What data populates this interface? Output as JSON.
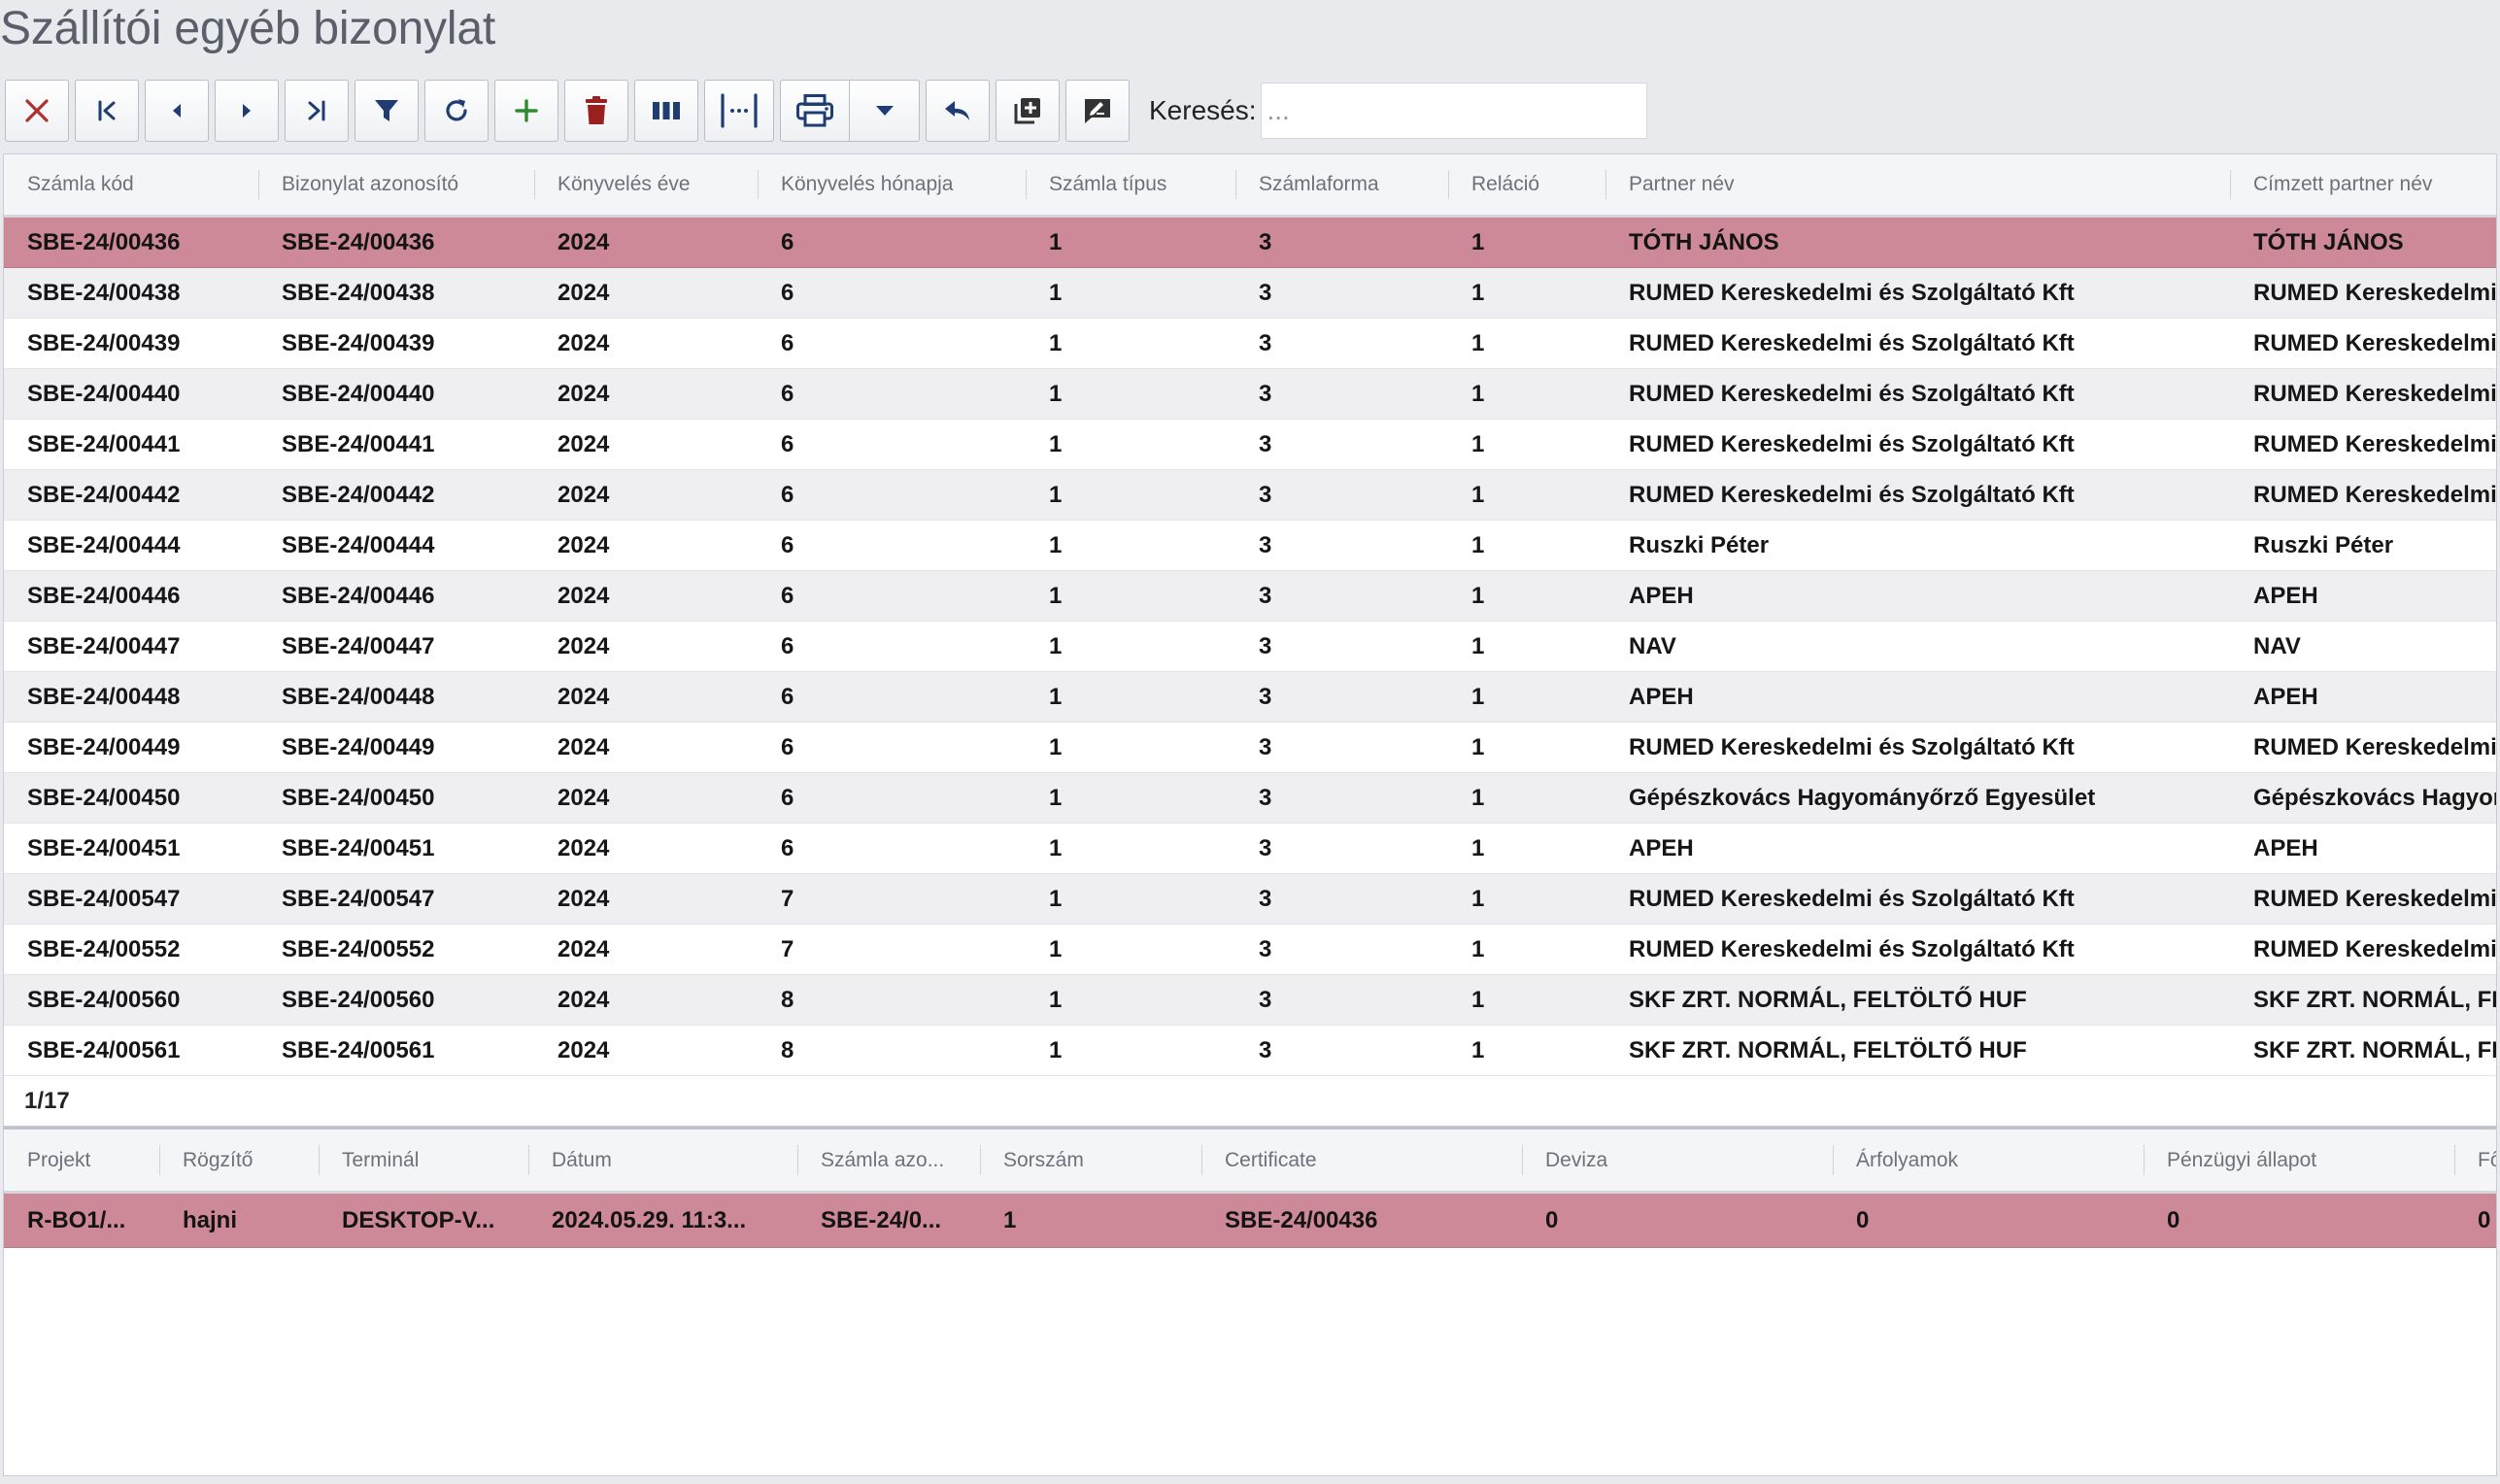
{
  "page_title": "Szállítói egyéb bizonylat",
  "toolbar": {
    "buttons": [
      {
        "name": "close-icon",
        "tooltip": ""
      },
      {
        "name": "first-record-icon"
      },
      {
        "name": "previous-record-icon"
      },
      {
        "name": "next-record-icon"
      },
      {
        "name": "last-record-icon"
      },
      {
        "name": "filter-icon"
      },
      {
        "name": "refresh-icon"
      },
      {
        "name": "add-icon"
      },
      {
        "name": "delete-icon"
      },
      {
        "name": "columns-icon"
      },
      {
        "name": "column-width-icon"
      },
      {
        "name": "print-icon"
      },
      {
        "name": "print-dropdown-icon"
      },
      {
        "name": "undo-icon"
      },
      {
        "name": "copy-icon"
      },
      {
        "name": "edit-note-icon"
      }
    ],
    "colors": {
      "close": "#b03030",
      "add": "#2e8b2e",
      "delete": "#9a1f1f",
      "icons": "#1f3c73"
    }
  },
  "search": {
    "label": "Keresés:",
    "placeholder": "...",
    "value": ""
  },
  "main_table": {
    "columns": [
      "Számla kód",
      "Bizonylat azonosító",
      "Könyvelés éve",
      "Könyvelés hónapja",
      "Számla típus",
      "Számlaforma",
      "Reláció",
      "Partner név",
      "Címzett partner név"
    ],
    "rows": [
      [
        "SBE-24/00436",
        "SBE-24/00436",
        "2024",
        "6",
        "1",
        "3",
        "1",
        "TÓTH JÁNOS",
        "TÓTH JÁNOS"
      ],
      [
        "SBE-24/00438",
        "SBE-24/00438",
        "2024",
        "6",
        "1",
        "3",
        "1",
        "RUMED Kereskedelmi és Szolgáltató Kft",
        "RUMED Kereskedelmi és Szolgáltató Kft"
      ],
      [
        "SBE-24/00439",
        "SBE-24/00439",
        "2024",
        "6",
        "1",
        "3",
        "1",
        "RUMED Kereskedelmi és Szolgáltató Kft",
        "RUMED Kereskedelmi és Szolgáltató Kft"
      ],
      [
        "SBE-24/00440",
        "SBE-24/00440",
        "2024",
        "6",
        "1",
        "3",
        "1",
        "RUMED Kereskedelmi és Szolgáltató Kft",
        "RUMED Kereskedelmi és Szolgáltató Kft"
      ],
      [
        "SBE-24/00441",
        "SBE-24/00441",
        "2024",
        "6",
        "1",
        "3",
        "1",
        "RUMED Kereskedelmi és Szolgáltató Kft",
        "RUMED Kereskedelmi és Szolgáltató Kft"
      ],
      [
        "SBE-24/00442",
        "SBE-24/00442",
        "2024",
        "6",
        "1",
        "3",
        "1",
        "RUMED Kereskedelmi és Szolgáltató Kft",
        "RUMED Kereskedelmi és Szolgáltató Kft"
      ],
      [
        "SBE-24/00444",
        "SBE-24/00444",
        "2024",
        "6",
        "1",
        "3",
        "1",
        "Ruszki Péter",
        "Ruszki Péter"
      ],
      [
        "SBE-24/00446",
        "SBE-24/00446",
        "2024",
        "6",
        "1",
        "3",
        "1",
        "APEH",
        "APEH"
      ],
      [
        "SBE-24/00447",
        "SBE-24/00447",
        "2024",
        "6",
        "1",
        "3",
        "1",
        "NAV",
        "NAV"
      ],
      [
        "SBE-24/00448",
        "SBE-24/00448",
        "2024",
        "6",
        "1",
        "3",
        "1",
        "APEH",
        "APEH"
      ],
      [
        "SBE-24/00449",
        "SBE-24/00449",
        "2024",
        "6",
        "1",
        "3",
        "1",
        "RUMED Kereskedelmi és Szolgáltató Kft",
        "RUMED Kereskedelmi és Szolgáltató Kft"
      ],
      [
        "SBE-24/00450",
        "SBE-24/00450",
        "2024",
        "6",
        "1",
        "3",
        "1",
        "Gépészkovács Hagyományőrző Egyesület",
        "Gépészkovács Hagyományőrző Egyesület"
      ],
      [
        "SBE-24/00451",
        "SBE-24/00451",
        "2024",
        "6",
        "1",
        "3",
        "1",
        "APEH",
        "APEH"
      ],
      [
        "SBE-24/00547",
        "SBE-24/00547",
        "2024",
        "7",
        "1",
        "3",
        "1",
        "RUMED Kereskedelmi és Szolgáltató Kft",
        "RUMED Kereskedelmi és Szolgáltató Kft"
      ],
      [
        "SBE-24/00552",
        "SBE-24/00552",
        "2024",
        "7",
        "1",
        "3",
        "1",
        "RUMED Kereskedelmi és Szolgáltató Kft",
        "RUMED Kereskedelmi és Szolgáltató Kft"
      ],
      [
        "SBE-24/00560",
        "SBE-24/00560",
        "2024",
        "8",
        "1",
        "3",
        "1",
        "SKF ZRT. NORMÁL, FELTÖLTŐ HUF",
        "SKF ZRT. NORMÁL, FELTÖLTŐ HUF"
      ],
      [
        "SBE-24/00561",
        "SBE-24/00561",
        "2024",
        "8",
        "1",
        "3",
        "1",
        "SKF ZRT. NORMÁL, FELTÖLTŐ HUF",
        "SKF ZRT. NORMÁL, FELTÖLTŐ HUF"
      ]
    ],
    "selected_row": 0,
    "pager": "1/17",
    "selected_color": "#cd8997"
  },
  "detail_table": {
    "columns": [
      "Projekt",
      "Rögzítő",
      "Terminál",
      "Dátum",
      "Számla azo...",
      "Sorszám",
      "Certificate",
      "Deviza",
      "Árfolyamok",
      "Pénzügyi állapot",
      "Fők"
    ],
    "rows": [
      [
        "R-BO1/...",
        "hajni",
        "DESKTOP-V...",
        "2024.05.29. 11:3...",
        "SBE-24/0...",
        "1",
        "SBE-24/00436",
        "0",
        "0",
        "0",
        "0"
      ]
    ],
    "selected_row": 0
  }
}
